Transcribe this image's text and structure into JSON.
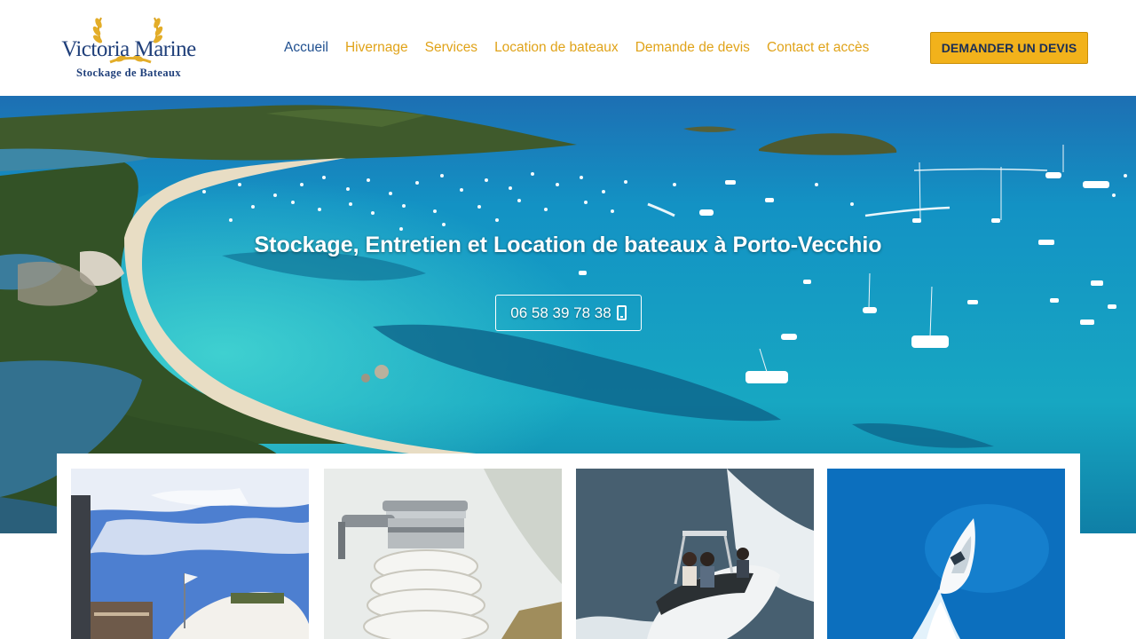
{
  "logo": {
    "title": "Victoria Marine",
    "subtitle": "Stockage de Bateaux"
  },
  "nav": {
    "items": [
      {
        "label": "Accueil",
        "active": true
      },
      {
        "label": "Hivernage",
        "active": false
      },
      {
        "label": "Services",
        "active": false
      },
      {
        "label": "Location de bateaux",
        "active": false
      },
      {
        "label": "Demande de devis",
        "active": false
      },
      {
        "label": "Contact et accès",
        "active": false
      }
    ]
  },
  "cta": {
    "label": "DEMANDER UN DEVIS"
  },
  "hero": {
    "title": "Stockage, Entretien et Location de bateaux à Porto-Vecchio",
    "phone": "06 58 39 78 38",
    "phone_icon": "mobile-phone-icon"
  },
  "colors": {
    "brand_blue": "#1f3f7a",
    "nav_gold": "#e0a319",
    "cta_yellow": "#f2b21b",
    "sea": "#1aa3c4"
  }
}
